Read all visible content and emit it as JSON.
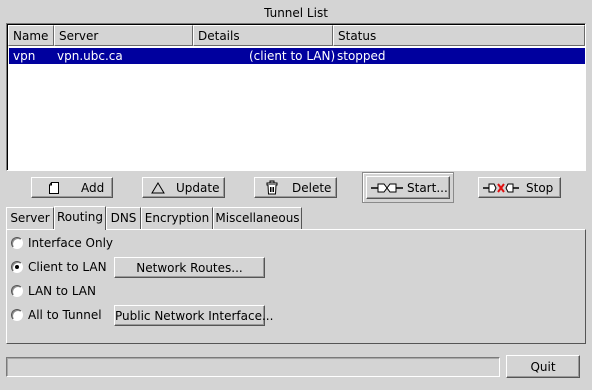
{
  "window": {
    "title": "Tunnel List"
  },
  "tunnel_list": {
    "columns": [
      "Name",
      "Server",
      "Details",
      "Status"
    ],
    "rows": [
      {
        "name": "vpn",
        "server": "vpn.ubc.ca",
        "details": "(client to LAN)",
        "status": "stopped",
        "selected": true
      }
    ]
  },
  "actions": {
    "add": "Add",
    "update": "Update",
    "delete": "Delete",
    "start": "Start...",
    "stop": "Stop"
  },
  "tabs": {
    "labels": [
      "Server",
      "Routing",
      "DNS",
      "Encryption",
      "Miscellaneous"
    ],
    "active": "Routing"
  },
  "routing": {
    "options": [
      {
        "label": "Interface Only",
        "checked": false
      },
      {
        "label": "Client to LAN",
        "checked": true
      },
      {
        "label": "LAN to LAN",
        "checked": false
      },
      {
        "label": "All to Tunnel",
        "checked": false
      }
    ],
    "network_routes_button": "Network Routes...",
    "public_interface_button": "Public Network Interface..."
  },
  "statusbar": {
    "text": ""
  },
  "quit_button": "Quit",
  "colors": {
    "background": "#d4d4d4",
    "selection": "#00009e",
    "selection_text": "#ffffff",
    "stop_accent": "#e01010"
  }
}
